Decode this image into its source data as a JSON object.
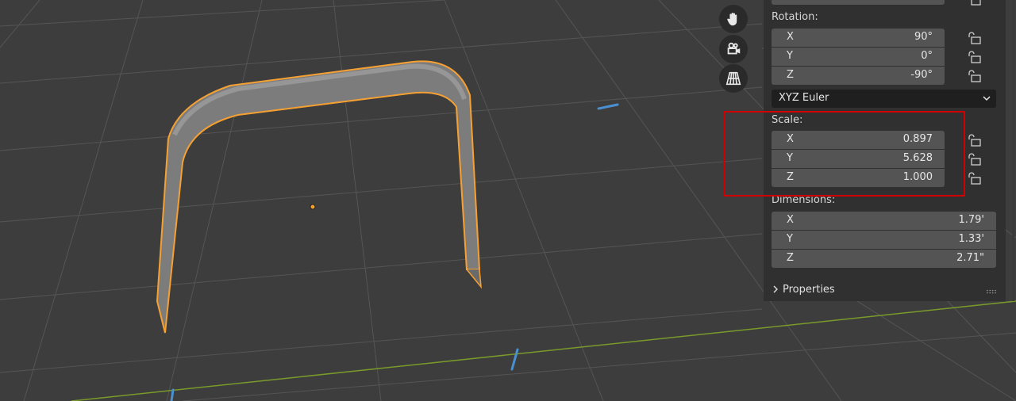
{
  "nav_icons": [
    "hand-icon",
    "camera-icon",
    "grid-view-icon"
  ],
  "transform": {
    "rotation": {
      "label": "Rotation:",
      "rows": [
        {
          "axis": "X",
          "value": "90°"
        },
        {
          "axis": "Y",
          "value": "0°"
        },
        {
          "axis": "Z",
          "value": "-90°"
        }
      ]
    },
    "rotation_mode": "XYZ Euler",
    "scale": {
      "label": "Scale:",
      "rows": [
        {
          "axis": "X",
          "value": "0.897"
        },
        {
          "axis": "Y",
          "value": "5.628"
        },
        {
          "axis": "Z",
          "value": "1.000"
        }
      ]
    },
    "dimensions": {
      "label": "Dimensions:",
      "rows": [
        {
          "axis": "X",
          "value": "1.79'"
        },
        {
          "axis": "Y",
          "value": "1.33'"
        },
        {
          "axis": "Z",
          "value": "2.71\""
        }
      ]
    }
  },
  "properties_label": "Properties",
  "colors": {
    "selection_outline": "#f5a033",
    "highlight_box": "#d10000",
    "x_axis_line": "#7a9a2a",
    "z_axis_dash": "#4a90d0"
  }
}
